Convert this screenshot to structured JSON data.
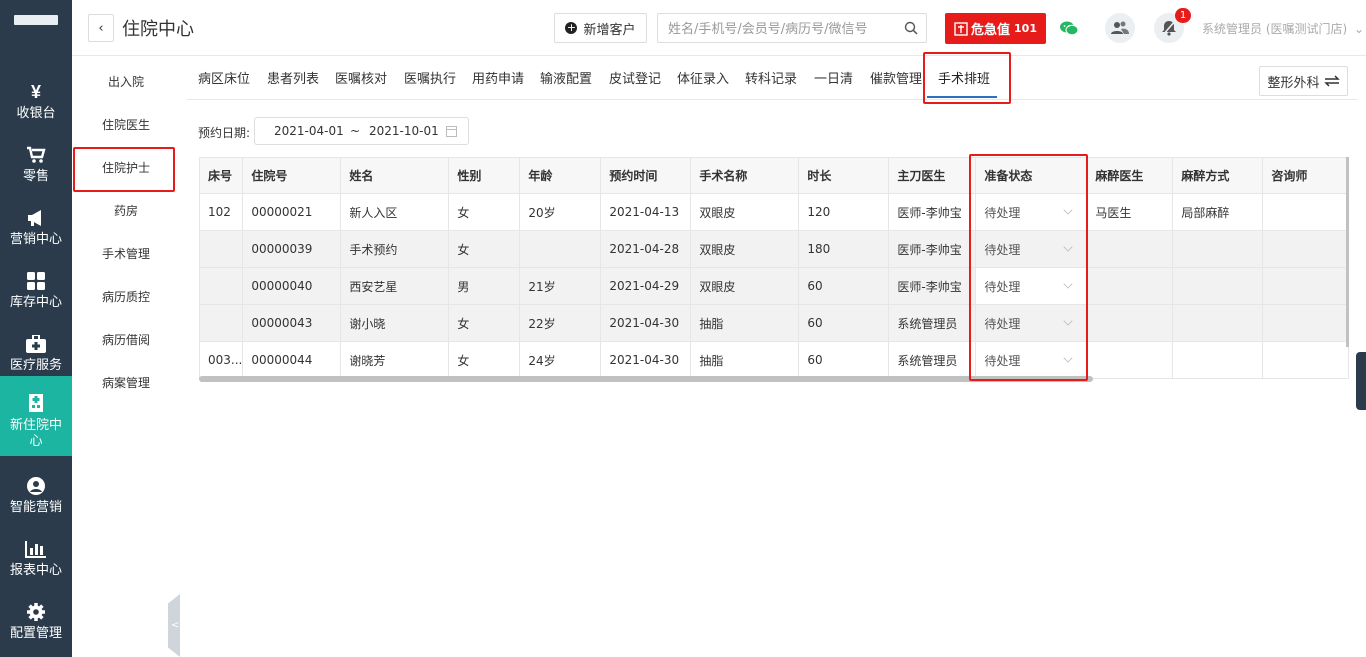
{
  "leftnav": {
    "items": [
      {
        "label": "收银台",
        "glyph": "¥",
        "icon": "yen-icon"
      },
      {
        "label": "零售",
        "glyph": "",
        "icon": "cart-icon"
      },
      {
        "label": "营销中心",
        "glyph": "",
        "icon": "megaphone-icon"
      },
      {
        "label": "库存中心",
        "glyph": "",
        "icon": "grid-icon"
      },
      {
        "label": "医疗服务",
        "glyph": "",
        "icon": "medkit-icon"
      },
      {
        "label": "新住院中心",
        "glyph": "",
        "icon": "hospital-icon"
      },
      {
        "label": "智能营销",
        "glyph": "",
        "icon": "smart-icon"
      },
      {
        "label": "报表中心",
        "glyph": "",
        "icon": "bar-chart-icon"
      },
      {
        "label": "配置管理",
        "glyph": "",
        "icon": "gear-icon"
      }
    ],
    "active_color": "#1bb5a2",
    "bg_color": "#2b3b4b"
  },
  "sub": {
    "items": [
      "出入院",
      "住院医生",
      "住院护士",
      "药房",
      "手术管理",
      "病历质控",
      "病历借阅",
      "病案管理"
    ]
  },
  "header": {
    "back_glyph": "‹",
    "title": "住院中心",
    "new_customer": "新增客户",
    "search_placeholder": "姓名/手机号/会员号/病历号/微信号",
    "alert_label": "危急值",
    "alert_count": "101",
    "notif_badge": "1",
    "user": "系统管理员 (医嘱测试门店)",
    "alert_color": "#e81b1b"
  },
  "tabs": [
    "病区床位",
    "患者列表",
    "医嘱核对",
    "医嘱执行",
    "用药申请",
    "输液配置",
    "皮试登记",
    "体征录入",
    "转科记录",
    "一日清",
    "催款管理",
    "手术排班"
  ],
  "dept_button": "整形外科",
  "filter": {
    "label": "预约日期:",
    "start": "2021-04-01",
    "sep": "~",
    "end": "2021-10-01"
  },
  "table": {
    "headers": [
      "床号",
      "住院号",
      "姓名",
      "性别",
      "年龄",
      "预约时间",
      "手术名称",
      "时长",
      "主刀医生",
      "准备状态",
      "麻醉医生",
      "麻醉方式",
      "咨询师"
    ],
    "rows": [
      [
        "102",
        "00000021",
        "新人入区",
        "女",
        "20岁",
        "2021-04-13",
        "双眼皮",
        "120",
        "医师-李帅宝",
        "待处理",
        "马医生",
        "局部麻醉",
        ""
      ],
      [
        "",
        "00000039",
        "手术预约",
        "女",
        "",
        "2021-04-28",
        "双眼皮",
        "180",
        "医师-李帅宝",
        "待处理",
        "",
        "",
        ""
      ],
      [
        "",
        "00000040",
        "西安艺星",
        "男",
        "21岁",
        "2021-04-29",
        "双眼皮",
        "60",
        "医师-李帅宝",
        "待处理",
        "",
        "",
        ""
      ],
      [
        "",
        "00000043",
        "谢小晓",
        "女",
        "22岁",
        "2021-04-30",
        "抽脂",
        "60",
        "系统管理员",
        "待处理",
        "",
        "",
        ""
      ],
      [
        "003...",
        "00000044",
        "谢晓芳",
        "女",
        "24岁",
        "2021-04-30",
        "抽脂",
        "60",
        "系统管理员",
        "待处理",
        "",
        "",
        ""
      ]
    ]
  }
}
